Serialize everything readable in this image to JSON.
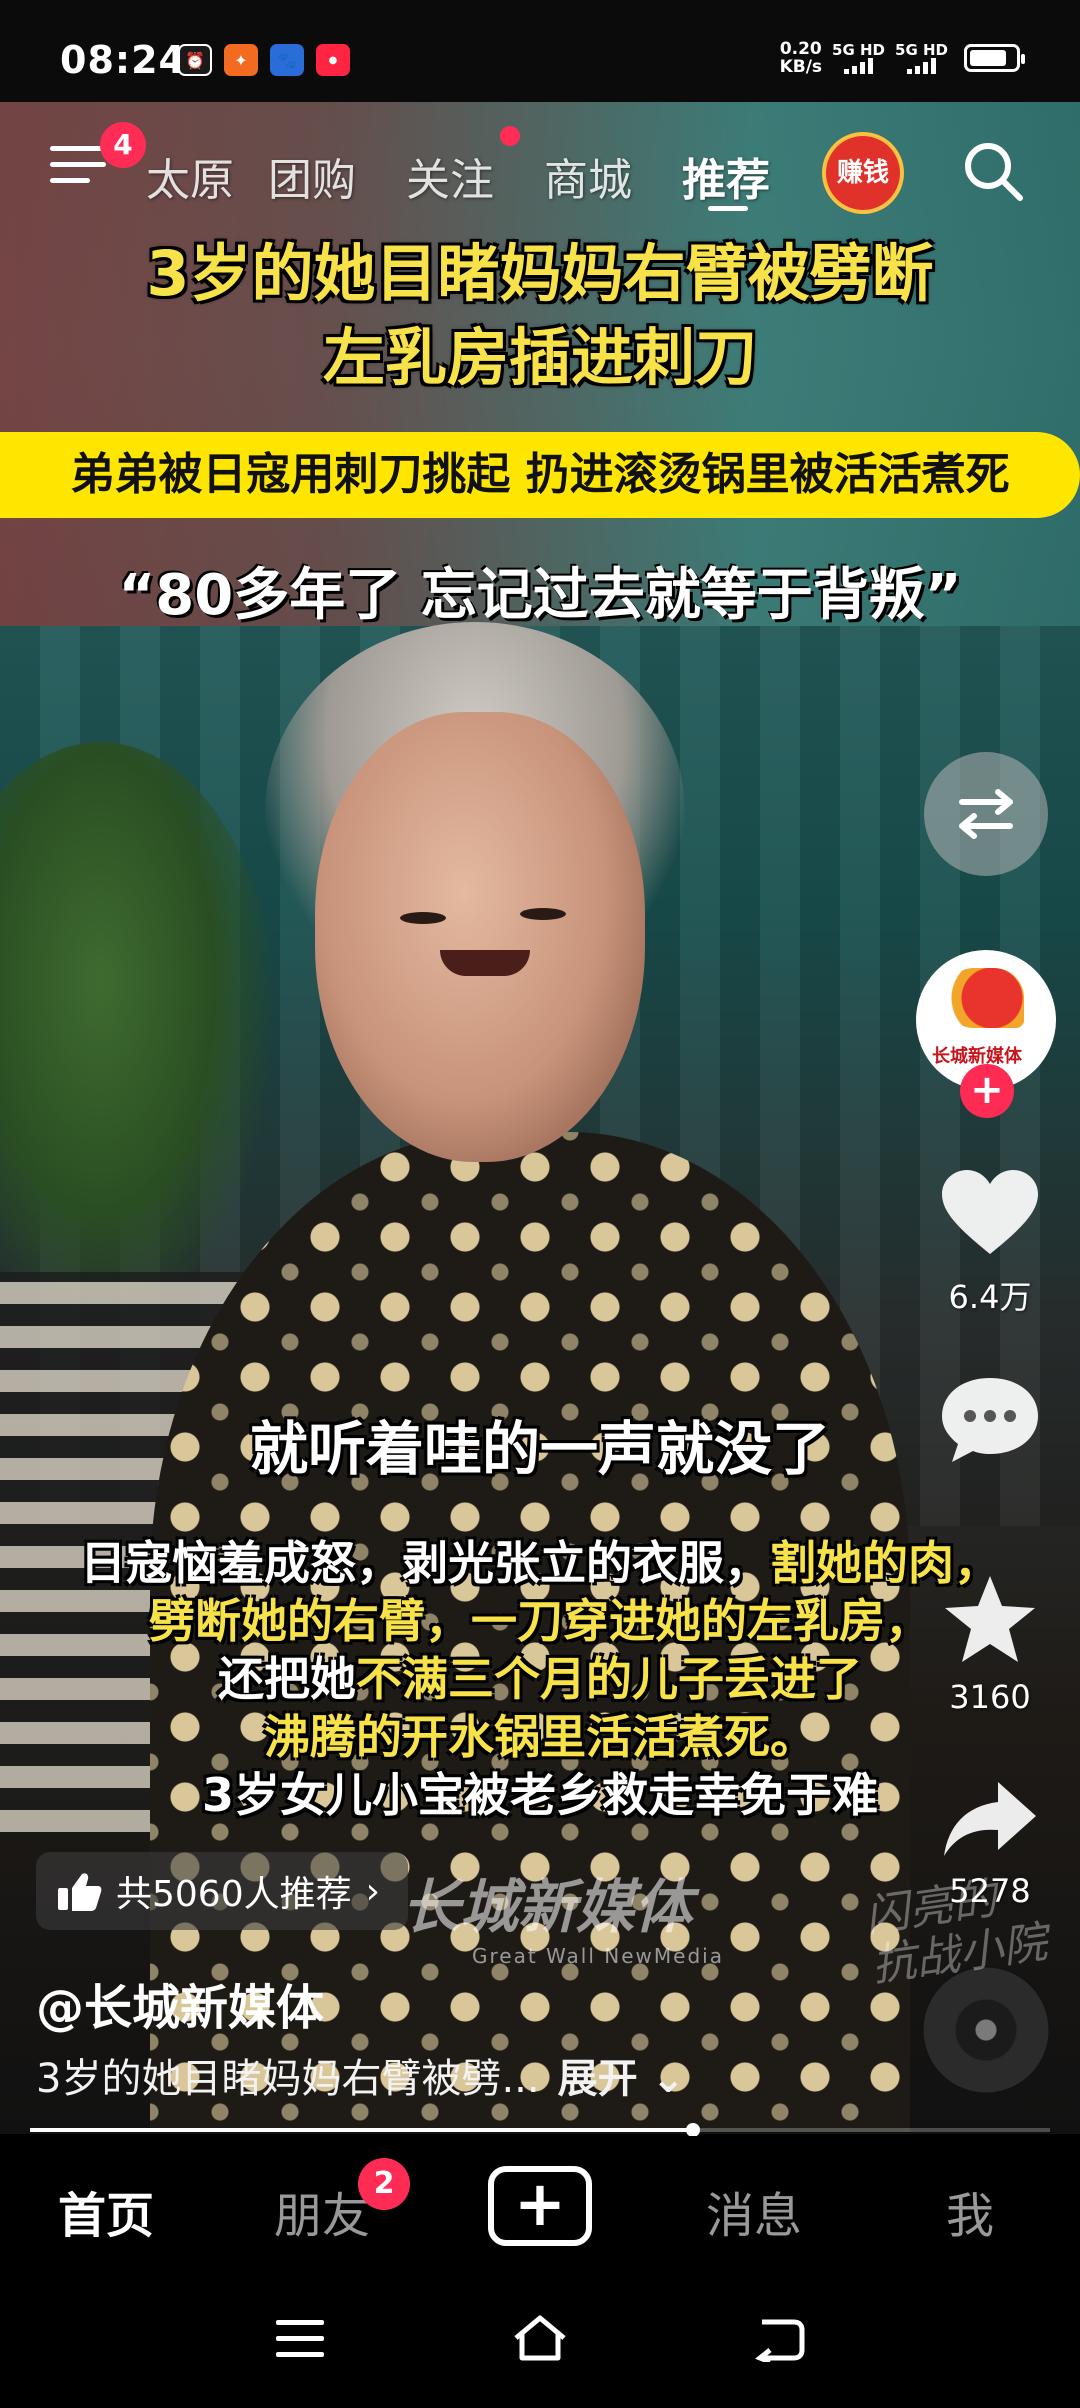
{
  "status_bar": {
    "time": "08:24",
    "speed_value": "0.20",
    "speed_unit": "KB/s",
    "signal1_label": "5G HD",
    "signal2_label": "5G HD",
    "apps": [
      {
        "icon": "alarm-app-icon",
        "color": "#1a1a1a"
      },
      {
        "icon": "shopping-app-icon",
        "color": "#f36b21"
      },
      {
        "icon": "baidu-app-icon",
        "color": "#2a6dd8"
      },
      {
        "icon": "xiaohongshu-app-icon",
        "color": "#ff2442"
      }
    ]
  },
  "top_nav": {
    "menu_badge": "4",
    "tabs": [
      {
        "label": "太原",
        "active": false
      },
      {
        "label": "团购",
        "active": false
      },
      {
        "label": "关注",
        "active": false,
        "dot": true
      },
      {
        "label": "商城",
        "active": false
      },
      {
        "label": "推荐",
        "active": true
      }
    ],
    "earn_label": "赚钱"
  },
  "video": {
    "headline_line1": "3岁的她目睹妈妈右臂被劈断",
    "headline_line2": "左乳房插进刺刀",
    "strip_text": "弟弟被日寇用刺刀挑起 扔进滚烫锅里被活活煮死",
    "quote": "“80多年了 忘记过去就等于背叛”",
    "subtitle_main": "就听着哇的一声就没了",
    "subtitle_block": {
      "line1_a": "日寇恼羞成怒，剥光张立的衣服，",
      "line1_b": "割她的肉，",
      "line2_a": "劈断她的右臂，一刀穿进她的左乳房，",
      "line3_a": "还把她",
      "line3_b": "不满三个月的儿子丢进了",
      "line4_b": "沸腾的开水锅里活活煮死。",
      "line5_a": "3岁女儿小宝被老乡救走幸免于难"
    },
    "watermark_cn": "长城新媒体",
    "watermark_en": "Great Wall NewMedia",
    "watermark_right_line1": "闪亮的",
    "watermark_right_line2": "抗战小院",
    "highlight_color": "#f7e24a"
  },
  "right_rail": {
    "avatar_text": "长城新媒体",
    "likes": "6.4万",
    "favorites": "3160",
    "shares": "5278"
  },
  "bottom_overlay": {
    "recommend_text": "共5060人推荐",
    "author": "@长城新媒体",
    "description": "3岁的她目睹妈妈右臂被劈...",
    "expand_label": "展开",
    "progress": 0.65
  },
  "tab_bar": {
    "home": "首页",
    "friends": "朋友",
    "friends_badge": "2",
    "messages": "消息",
    "me": "我"
  },
  "accent_color": "#fe2c55"
}
